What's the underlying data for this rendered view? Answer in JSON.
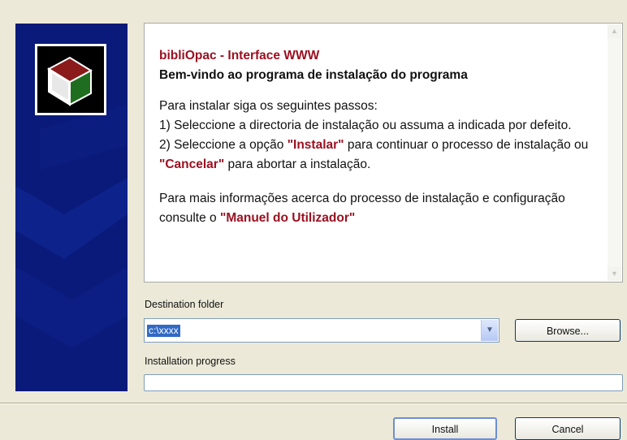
{
  "info": {
    "title_line1": "bibliOpac - Interface WWW",
    "title_line2": "Bem-vindo ao programa de instalação do programa",
    "steps_intro": "Para instalar siga os seguintes passos:",
    "step1": "1) Seleccione a directoria de instalação ou assuma a indicada por defeito.",
    "step2_a": "2) Seleccione a opção ",
    "step2_install": "\"Instalar\"",
    "step2_b": " para continuar o processo de instalação ou ",
    "step2_cancel": "\"Cancelar\"",
    "step2_c": " para abortar a instalação.",
    "more_a": "Para mais informações acerca do processo de instalação e configuração consulte o ",
    "more_manual": "\"Manuel do Utilizador\""
  },
  "destination": {
    "label": "Destination folder",
    "value": "c:\\xxxx",
    "browse_label": "Browse..."
  },
  "progress": {
    "label": "Installation progress",
    "value": 0
  },
  "actions": {
    "install_label": "Install",
    "cancel_label": "Cancel"
  },
  "colors": {
    "side_panel": "#0a1a7a",
    "highlight_red": "#9b1020",
    "selection_blue": "#316ac5"
  },
  "icons": {
    "logo": "book-logo-icon",
    "scroll_up": "scroll-up-icon",
    "scroll_down": "scroll-down-icon",
    "dropdown": "chevron-down-icon"
  }
}
